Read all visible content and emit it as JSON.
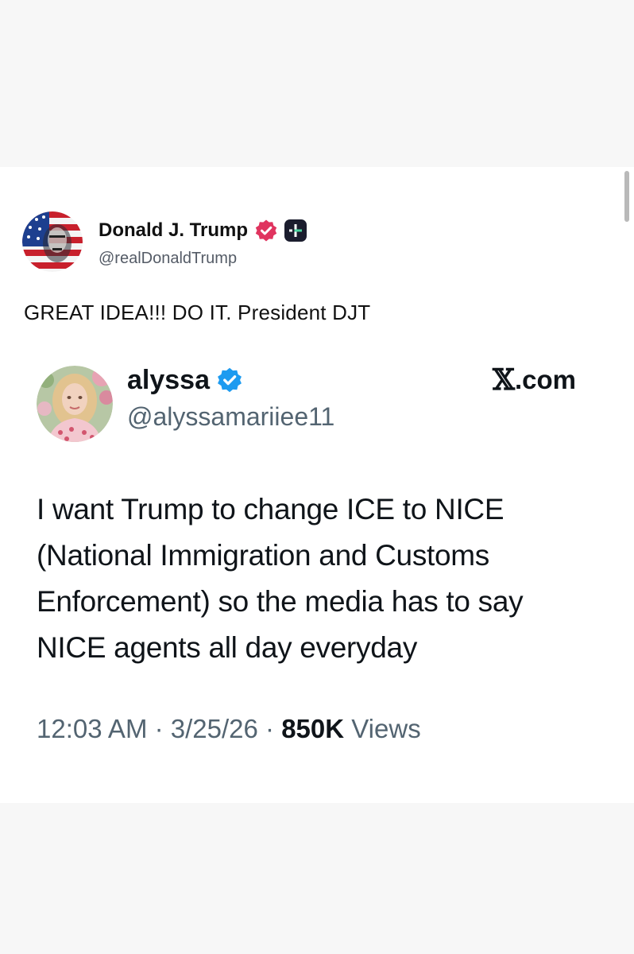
{
  "truth_post": {
    "author_name": "Donald J. Trump",
    "author_handle": "@realDonaldTrump",
    "text": "GREAT IDEA!!! DO IT. President DJT",
    "verified_icon": "verified-badge-pink",
    "app_logo_icon": "truth-social-logo"
  },
  "embedded_post": {
    "author_name": "alyssa",
    "author_handle": "@alyssamariiee11",
    "brand": {
      "glyph": "𝕏",
      "suffix": ".com"
    },
    "body_lines": [
      "I want Trump to change ICE to NICE",
      "(National Immigration and Customs",
      "Enforcement) so the media has to say",
      "NICE agents all day everyday"
    ],
    "time": "12:03 AM",
    "date": "3/25/26",
    "separator": " · ",
    "views_count": "850K",
    "views_label": " Views",
    "verified_icon": "verified-badge-blue"
  },
  "colors": {
    "page_background": "#f7f7f7",
    "card_background": "#ffffff",
    "truth_badge_pink": "#e0345f",
    "x_verified_blue": "#1d9bf0",
    "x_secondary_text": "#536471",
    "truth_logo_dark": "#1b1d2e"
  }
}
